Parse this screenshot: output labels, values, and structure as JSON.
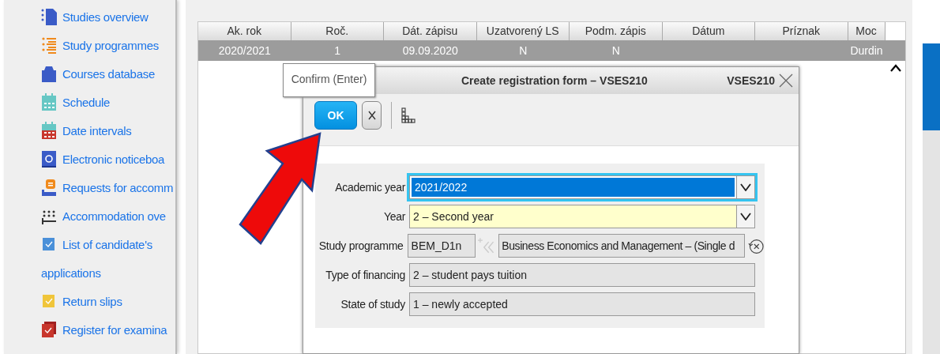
{
  "sidebar": {
    "items": [
      {
        "label": "Studies overview",
        "kind": "document"
      },
      {
        "label": "Study programmes",
        "kind": "list"
      },
      {
        "label": "Courses database",
        "kind": "bag"
      },
      {
        "label": "Schedule",
        "kind": "calendar"
      },
      {
        "label": "Date intervals",
        "kind": "calendar-red"
      },
      {
        "label": "Electronic noticeboa",
        "kind": "noticeboard"
      },
      {
        "label": "Requests for accomm",
        "kind": "request"
      },
      {
        "label": "Accommodation ove",
        "kind": "beds"
      },
      {
        "label": "List of candidate's applications",
        "kind": "check-blue"
      },
      {
        "label": "Return slips",
        "kind": "check-yellow"
      },
      {
        "label": "Register for examina",
        "kind": "check-red"
      }
    ]
  },
  "table": {
    "columns": [
      "Ak. rok",
      "Roč.",
      "Dát. zápisu",
      "Uzatvorený LS",
      "Podm. zápis",
      "Dátum",
      "Príznak",
      "Moc"
    ],
    "rows": [
      {
        "selected": true,
        "cells": [
          "2020/2021",
          "1",
          "09.09.2020",
          "N",
          "N",
          null,
          null,
          "Durdin"
        ]
      }
    ]
  },
  "dialog": {
    "title": "Create registration form – VSES210",
    "code": "VSES210",
    "ok": "OK",
    "fields": [
      {
        "kind": "select",
        "label": "Academic year",
        "value": "2021/2022",
        "focused": true,
        "required": false
      },
      {
        "kind": "select",
        "label": "Year",
        "value": "2 – Second year",
        "focused": false,
        "required": true
      },
      {
        "kind": "lookup",
        "label": "Study programme",
        "code": "BEM_D1n",
        "value": "Business Economics and Management – (Single d"
      },
      {
        "kind": "text",
        "label": "Type of financing",
        "value": "2 – student pays tuition"
      },
      {
        "kind": "text",
        "label": "State of study",
        "value": "1 – newly accepted"
      }
    ]
  },
  "tooltip": "Confirm (Enter)",
  "annotation": {
    "kind": "arrow"
  }
}
